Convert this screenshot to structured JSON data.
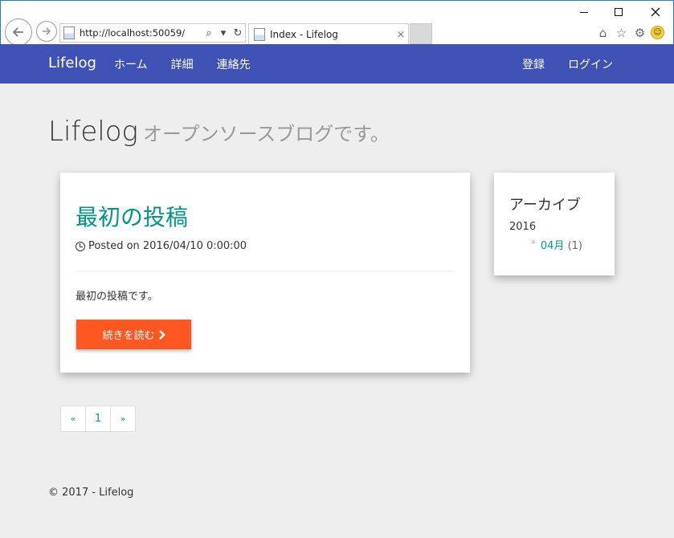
{
  "browser": {
    "url": "http://localhost:50059/",
    "tab_title": "Index - Lifelog",
    "search_glyph": "⌕",
    "dropdown_glyph": "▾",
    "refresh_glyph": "↻",
    "close_glyph": "×",
    "home_glyph": "⌂",
    "star_glyph": "☆",
    "gear_glyph": "⚙",
    "smiley_glyph": "☺"
  },
  "navbar": {
    "brand": "Lifelog",
    "links": [
      "ホーム",
      "詳細",
      "連絡先"
    ],
    "right_links": [
      "登録",
      "ログイン"
    ],
    "color": "#3f51b5"
  },
  "header": {
    "title": "Lifelog",
    "subtitle": "オープンソースブログです。"
  },
  "post": {
    "title": "最初の投稿",
    "meta": "Posted on 2016/04/10 0:00:00",
    "body": "最初の投稿です。",
    "read_more": "続きを読む",
    "accent": "#009688",
    "button_color": "#ff5722"
  },
  "archive": {
    "title": "アーカイブ",
    "year": "2016",
    "month_link": "04月",
    "count": "(1)"
  },
  "pagination": {
    "prev": "«",
    "current": "1",
    "next": "»"
  },
  "footer": {
    "text": "© 2017 - Lifelog"
  }
}
